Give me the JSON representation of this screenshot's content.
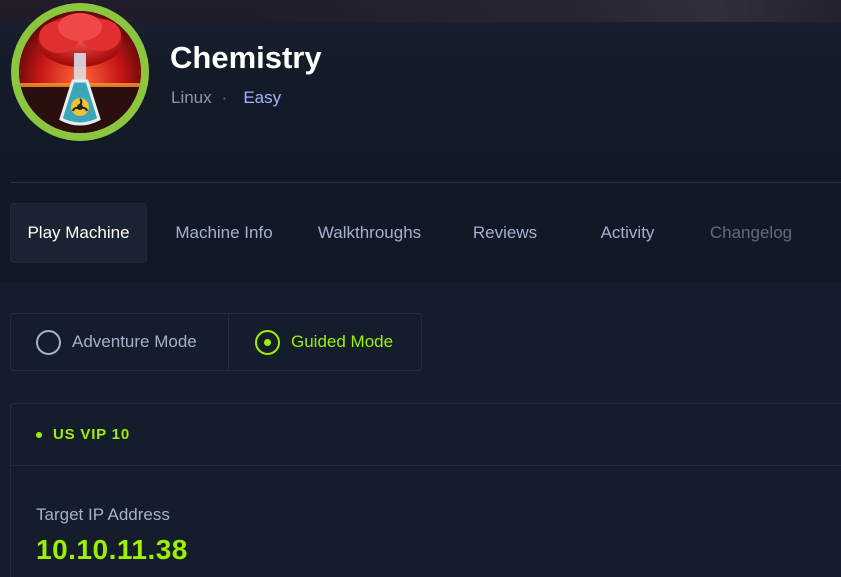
{
  "machine": {
    "name": "Chemistry",
    "os": "Linux",
    "separator": "·",
    "difficulty": "Easy",
    "avatar_icon": "biohazard-flask-icon"
  },
  "tabs": [
    {
      "label": "Play Machine",
      "state": "active"
    },
    {
      "label": "Machine Info",
      "state": "normal"
    },
    {
      "label": "Walkthroughs",
      "state": "normal"
    },
    {
      "label": "Reviews",
      "state": "normal"
    },
    {
      "label": "Activity",
      "state": "normal"
    },
    {
      "label": "Changelog",
      "state": "disabled"
    }
  ],
  "modes": {
    "adventure": {
      "label": "Adventure Mode",
      "selected": false
    },
    "guided": {
      "label": "Guided Mode",
      "selected": true
    }
  },
  "server": {
    "name": "US VIP 10",
    "ip_label": "Target IP Address",
    "ip_value": "10.10.11.38"
  },
  "colors": {
    "accent_green": "#9fef00",
    "background": "#111927",
    "panel": "#141d2b",
    "text_muted": "#a4b1cd",
    "difficulty_blue": "#9fb6ff",
    "avatar_ring": "#8cc63f"
  }
}
